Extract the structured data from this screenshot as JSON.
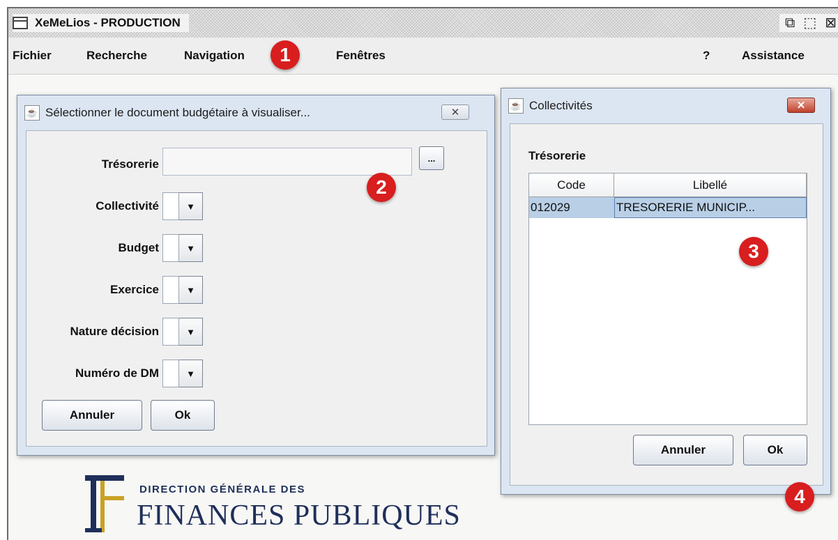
{
  "window": {
    "title": "XeMeLios - PRODUCTION",
    "controls": [
      "minimize-icon",
      "maximize-icon",
      "close-icon"
    ]
  },
  "menubar": {
    "items": [
      "Fichier",
      "Recherche",
      "Navigation",
      "Fenêtres"
    ],
    "right_items": [
      "?",
      "Assistance"
    ]
  },
  "markers": [
    "1",
    "2",
    "3",
    "4"
  ],
  "select_dialog": {
    "title": "Sélectionner le document budgétaire à visualiser...",
    "close_glyph": "✕",
    "tresorerie_label": "Trésorerie",
    "browse_label": "...",
    "fields": [
      "Collectivité",
      "Budget",
      "Exercice",
      "Nature décision",
      "Numéro de DM"
    ],
    "cancel_label": "Annuler",
    "ok_label": "Ok"
  },
  "collectivites_dialog": {
    "title": "Collectivités",
    "close_glyph": "✕",
    "section_label": "Trésorerie",
    "columns": [
      "Code",
      "Libellé"
    ],
    "rows": [
      {
        "code": "012029",
        "libelle": "TRESORERIE MUNICIP..."
      }
    ],
    "cancel_label": "Annuler",
    "ok_label": "Ok"
  },
  "logo": {
    "line1": "DIRECTION GÉNÉRALE DES",
    "line2": "FINANCES PUBLIQUES"
  },
  "colors": {
    "marker_red": "#d81e1e",
    "dialog_frame": "#dce6f2",
    "selection_blue": "#b8cfe6",
    "logo_navy": "#1f2f5a",
    "logo_gold": "#c9a227"
  }
}
